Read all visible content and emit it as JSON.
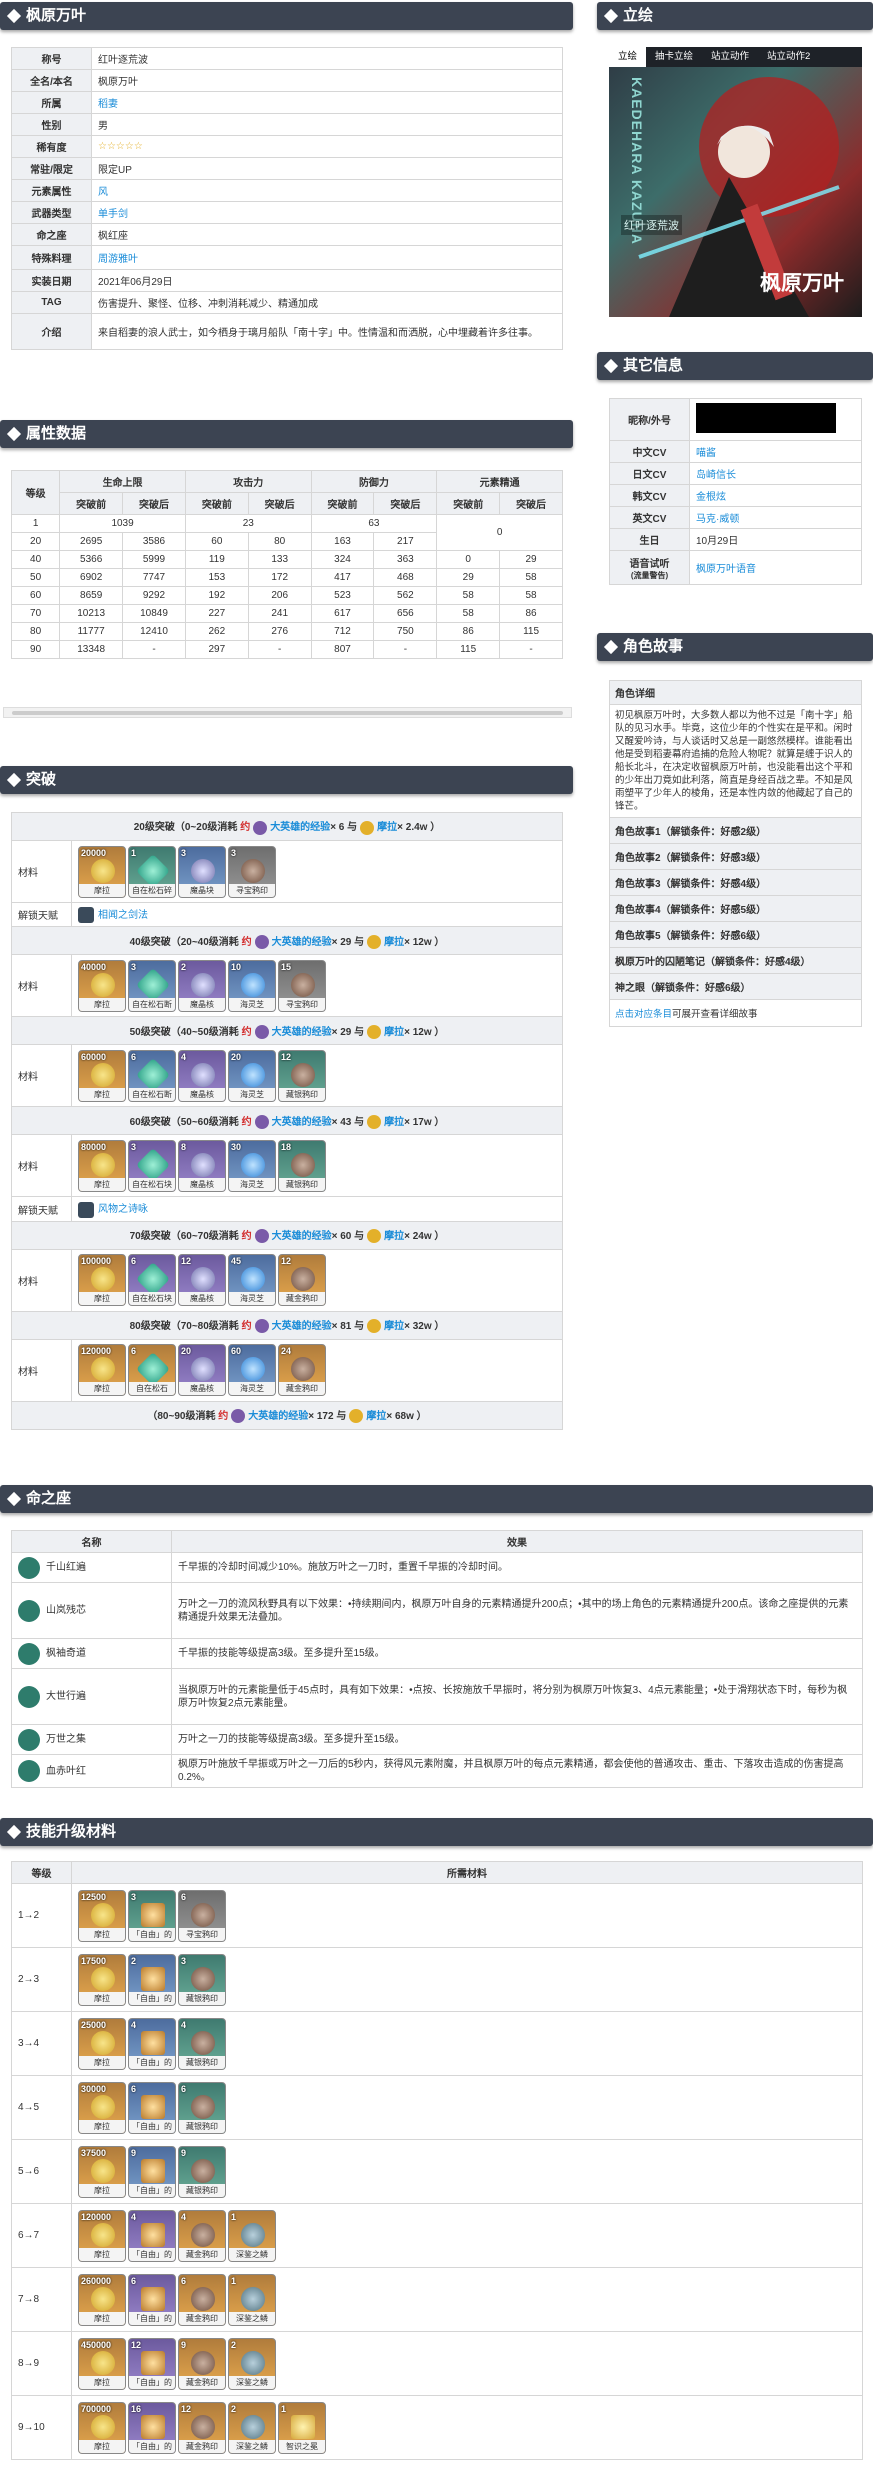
{
  "sections": {
    "main": "枫原万叶",
    "attr": "属性数据",
    "ascension": "突破",
    "constellation": "命之座",
    "talent_mats": "技能升级材料",
    "portrait": "立绘",
    "other": "其它信息",
    "story": "角色故事"
  },
  "info": [
    {
      "k": "称号",
      "v": "红叶逐荒波"
    },
    {
      "k": "全名/本名",
      "v": "枫原万叶"
    },
    {
      "k": "所属",
      "v": "稻妻",
      "link": true
    },
    {
      "k": "性别",
      "v": "男"
    },
    {
      "k": "稀有度",
      "v": "☆☆☆☆☆",
      "stars": true
    },
    {
      "k": "常驻/限定",
      "v": "限定UP"
    },
    {
      "k": "元素属性",
      "v": "风",
      "link": true
    },
    {
      "k": "武器类型",
      "v": "单手剑",
      "link": true
    },
    {
      "k": "命之座",
      "v": "枫红座"
    },
    {
      "k": "特殊料理",
      "v": "周游雅叶",
      "link": true
    },
    {
      "k": "实装日期",
      "v": "2021年06月29日"
    },
    {
      "k": "TAG",
      "v": "伤害提升、聚怪、位移、冲刺消耗减少、精通加成"
    },
    {
      "k": "介绍",
      "v": "来自稻妻的浪人武士，如今栖身于璃月船队「南十字」中。性情温和而洒脱，心中埋藏着许多往事。"
    }
  ],
  "stats": {
    "group_headers": [
      "等级",
      "生命上限",
      "攻击力",
      "防御力",
      "元素精通"
    ],
    "sub_headers": [
      "突破前",
      "突破后",
      "突破前",
      "突破后",
      "突破前",
      "突破后",
      "突破前",
      "突破后"
    ],
    "row1": {
      "level": "1",
      "hp": "1039",
      "atk": "23",
      "def": "63",
      "em": "0"
    },
    "rows": [
      [
        "20",
        "2695",
        "3586",
        "60",
        "80",
        "163",
        "217"
      ],
      [
        "40",
        "5366",
        "5999",
        "119",
        "133",
        "324",
        "363",
        "0",
        "29"
      ],
      [
        "50",
        "6902",
        "7747",
        "153",
        "172",
        "417",
        "468",
        "29",
        "58"
      ],
      [
        "60",
        "8659",
        "9292",
        "192",
        "206",
        "523",
        "562",
        "58",
        "58"
      ],
      [
        "70",
        "10213",
        "10849",
        "227",
        "241",
        "617",
        "656",
        "58",
        "86"
      ],
      [
        "80",
        "11777",
        "12410",
        "262",
        "276",
        "712",
        "750",
        "86",
        "115"
      ],
      [
        "90",
        "13348",
        "-",
        "297",
        "-",
        "807",
        "-",
        "115",
        "-"
      ]
    ]
  },
  "ascension": {
    "materials_label": "材料",
    "talent_label": "解锁天赋",
    "phases": [
      {
        "title": "20级突破（0~20级消耗",
        "book": "大英雄的经验",
        "books": "× 6",
        "and": "与",
        "mora": "摩拉",
        "moraamt": "× 2.4w ）",
        "items": [
          [
            "20000",
            "摩拉",
            "q5",
            "coin"
          ],
          [
            "1",
            "自在松石碎屑",
            "q2",
            "gem"
          ],
          [
            "3",
            "魔晶块",
            "q3",
            "feather"
          ],
          [
            "3",
            "寻宝鸦印",
            "q1",
            "mark"
          ]
        ],
        "talent": "相闻之剑法"
      },
      {
        "title": "40级突破（20~40级消耗",
        "book": "大英雄的经验",
        "books": "× 29",
        "and": "与",
        "mora": "摩拉",
        "moraamt": "× 12w ）",
        "items": [
          [
            "40000",
            "摩拉",
            "q5",
            "coin"
          ],
          [
            "3",
            "自在松石断片",
            "q3",
            "gem"
          ],
          [
            "2",
            "魔晶核",
            "q4",
            "feather"
          ],
          [
            "10",
            "海灵芝",
            "q3",
            "flower"
          ],
          [
            "15",
            "寻宝鸦印",
            "q1",
            "mark"
          ]
        ]
      },
      {
        "title": "50级突破（40~50级消耗",
        "book": "大英雄的经验",
        "books": "× 29",
        "and": "与",
        "mora": "摩拉",
        "moraamt": "× 12w ）",
        "items": [
          [
            "60000",
            "摩拉",
            "q5",
            "coin"
          ],
          [
            "6",
            "自在松石断片",
            "q3",
            "gem"
          ],
          [
            "4",
            "魔晶核",
            "q4",
            "feather"
          ],
          [
            "20",
            "海灵芝",
            "q3",
            "flower"
          ],
          [
            "12",
            "藏银鸦印",
            "q2",
            "mark"
          ]
        ]
      },
      {
        "title": "60级突破（50~60级消耗",
        "book": "大英雄的经验",
        "books": "× 43",
        "and": "与",
        "mora": "摩拉",
        "moraamt": "× 17w ）",
        "items": [
          [
            "80000",
            "摩拉",
            "q5",
            "coin"
          ],
          [
            "3",
            "自在松石块",
            "q4",
            "gem"
          ],
          [
            "8",
            "魔晶核",
            "q4",
            "feather"
          ],
          [
            "30",
            "海灵芝",
            "q3",
            "flower"
          ],
          [
            "18",
            "藏银鸦印",
            "q2",
            "mark"
          ]
        ],
        "talent": "风物之诗咏"
      },
      {
        "title": "70级突破（60~70级消耗",
        "book": "大英雄的经验",
        "books": "× 60",
        "and": "与",
        "mora": "摩拉",
        "moraamt": "× 24w ）",
        "items": [
          [
            "100000",
            "摩拉",
            "q5",
            "coin"
          ],
          [
            "6",
            "自在松石块",
            "q4",
            "gem"
          ],
          [
            "12",
            "魔晶核",
            "q4",
            "feather"
          ],
          [
            "45",
            "海灵芝",
            "q3",
            "flower"
          ],
          [
            "12",
            "藏金鸦印",
            "q5",
            "mark"
          ]
        ]
      },
      {
        "title": "80级突破（70~80级消耗",
        "book": "大英雄的经验",
        "books": "× 81",
        "and": "与",
        "mora": "摩拉",
        "moraamt": "× 32w ）",
        "items": [
          [
            "120000",
            "摩拉",
            "q5",
            "coin"
          ],
          [
            "6",
            "自在松石",
            "q5",
            "gem"
          ],
          [
            "20",
            "魔晶核",
            "q4",
            "feather"
          ],
          [
            "60",
            "海灵芝",
            "q3",
            "flower"
          ],
          [
            "24",
            "藏金鸦印",
            "q5",
            "mark"
          ]
        ]
      }
    ],
    "final": {
      "title": "（80~90级消耗",
      "book": "大英雄的经验",
      "books": "× 172",
      "and": "与",
      "mora": "摩拉",
      "moraamt": "× 68w ）"
    }
  },
  "constellation": {
    "headers": [
      "名称",
      "效果"
    ],
    "rows": [
      {
        "name": "千山红遍",
        "effect": "千早振的冷却时间减少10%。施放万叶之一刀时，重置千早振的冷却时间。"
      },
      {
        "name": "山岚残芯",
        "effect": "万叶之一刀的流风秋野具有以下效果：•持续期间内，枫原万叶自身的元素精通提升200点；•其中的场上角色的元素精通提升200点。该命之座提供的元素精通提升效果无法叠加。"
      },
      {
        "name": "枫袖奇道",
        "effect": "千早振的技能等级提高3级。至多提升至15级。"
      },
      {
        "name": "大世行遍",
        "effect": "当枫原万叶的元素能量低于45点时，具有如下效果：•点按、长按施放千早振时，将分别为枫原万叶恢复3、4点元素能量；•处于滑翔状态下时，每秒为枫原万叶恢复2点元素能量。"
      },
      {
        "name": "万世之集",
        "effect": "万叶之一刀的技能等级提高3级。至多提升至15级。"
      },
      {
        "name": "血赤叶红",
        "effect": "枫原万叶施放千早振或万叶之一刀后的5秒内，获得风元素附魔，并且枫原万叶的每点元素精通，都会使他的普通攻击、重击、下落攻击造成的伤害提高0.2%。"
      }
    ]
  },
  "talent": {
    "headers": [
      "等级",
      "所需材料"
    ],
    "rows": [
      {
        "lv": "1→2",
        "items": [
          [
            "12500",
            "摩拉",
            "q5",
            "coin"
          ],
          [
            "3",
            "「自由」的教导",
            "q2",
            "scroll"
          ],
          [
            "6",
            "寻宝鸦印",
            "q1",
            "mark"
          ]
        ]
      },
      {
        "lv": "2→3",
        "items": [
          [
            "17500",
            "摩拉",
            "q5",
            "coin"
          ],
          [
            "2",
            "「自由」的指引",
            "q3",
            "scroll"
          ],
          [
            "3",
            "藏银鸦印",
            "q2",
            "mark"
          ]
        ]
      },
      {
        "lv": "3→4",
        "items": [
          [
            "25000",
            "摩拉",
            "q5",
            "coin"
          ],
          [
            "4",
            "「自由」的指引",
            "q3",
            "scroll"
          ],
          [
            "4",
            "藏银鸦印",
            "q2",
            "mark"
          ]
        ]
      },
      {
        "lv": "4→5",
        "items": [
          [
            "30000",
            "摩拉",
            "q5",
            "coin"
          ],
          [
            "6",
            "「自由」的指引",
            "q3",
            "scroll"
          ],
          [
            "6",
            "藏银鸦印",
            "q2",
            "mark"
          ]
        ]
      },
      {
        "lv": "5→6",
        "items": [
          [
            "37500",
            "摩拉",
            "q5",
            "coin"
          ],
          [
            "9",
            "「自由」的指引",
            "q3",
            "scroll"
          ],
          [
            "9",
            "藏银鸦印",
            "q2",
            "mark"
          ]
        ]
      },
      {
        "lv": "6→7",
        "items": [
          [
            "120000",
            "摩拉",
            "q5",
            "coin"
          ],
          [
            "4",
            "「自由」的哲学",
            "q4",
            "scroll"
          ],
          [
            "4",
            "藏金鸦印",
            "q5",
            "mark"
          ],
          [
            "1",
            "深鉴之鳞",
            "q5",
            "guard"
          ]
        ]
      },
      {
        "lv": "7→8",
        "items": [
          [
            "260000",
            "摩拉",
            "q5",
            "coin"
          ],
          [
            "6",
            "「自由」的哲学",
            "q4",
            "scroll"
          ],
          [
            "6",
            "藏金鸦印",
            "q5",
            "mark"
          ],
          [
            "1",
            "深鉴之鳞",
            "q5",
            "guard"
          ]
        ]
      },
      {
        "lv": "8→9",
        "items": [
          [
            "450000",
            "摩拉",
            "q5",
            "coin"
          ],
          [
            "12",
            "「自由」的哲学",
            "q4",
            "scroll"
          ],
          [
            "9",
            "藏金鸦印",
            "q5",
            "mark"
          ],
          [
            "2",
            "深鉴之鳞",
            "q5",
            "guard"
          ]
        ]
      },
      {
        "lv": "9→10",
        "items": [
          [
            "700000",
            "摩拉",
            "q5",
            "coin"
          ],
          [
            "16",
            "「自由」的哲学",
            "q4",
            "scroll"
          ],
          [
            "12",
            "藏金鸦印",
            "q5",
            "mark"
          ],
          [
            "2",
            "深鉴之鳞",
            "q5",
            "guard"
          ],
          [
            "1",
            "智识之冕",
            "q5",
            "crown"
          ]
        ]
      }
    ]
  },
  "portrait": {
    "tabs": [
      "立绘",
      "抽卡立绘",
      "站立动作",
      "站立动作2"
    ],
    "name_en": "KAEDEHARA KAZUHA",
    "title_cn": "红叶逐荒波",
    "name_cn": "枫原万叶"
  },
  "other": [
    {
      "k": "昵称/外号",
      "v": "",
      "redacted": true
    },
    {
      "k": "中文CV",
      "v": "喵酱",
      "link": true
    },
    {
      "k": "日文CV",
      "v": "岛崎信长",
      "link": true
    },
    {
      "k": "韩文CV",
      "v": "金根炫",
      "link": true
    },
    {
      "k": "英文CV",
      "v": "马克·威顿",
      "link": true
    },
    {
      "k": "生日",
      "v": "10月29日"
    },
    {
      "k": "语音试听",
      "v": "枫原万叶语音",
      "sub": "(流量警告)",
      "link": true
    }
  ],
  "story": {
    "detail_title": "角色详细",
    "detail_text": "初见枫原万叶时，大多数人都以为他不过是「南十字」船队的见习水手。毕竟，这位少年的个性实在是平和。闲时又醒爱吟诗，与人谈话时又总是一副悠然模样。谁能看出他是受到稻妻幕府追捕的危险人物呢？就算是缠于识人的船长北斗，在决定收留枫原万叶前，也没能看出这个平和的少年出刀竟如此利落，简直是身经百战之辈。不知是风雨塑平了少年人的棱角，还是本性内敛的他藏起了自己的锋芒。",
    "items": [
      "角色故事1（解锁条件：好感2级）",
      "角色故事2（解锁条件：好感3级）",
      "角色故事3（解锁条件：好感4级）",
      "角色故事4（解锁条件：好感5级）",
      "角色故事5（解锁条件：好感6级）",
      "枫原万叶的囚陋笔记（解锁条件：好感4级）",
      "神之眼（解锁条件：好感6级）"
    ],
    "foot_link": "点击对应条目",
    "foot_text": "可展开查看详细故事"
  }
}
